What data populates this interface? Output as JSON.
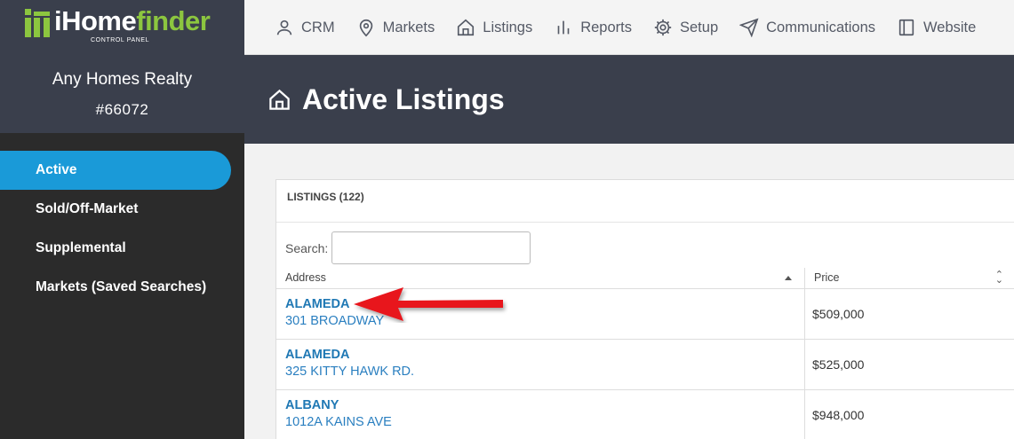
{
  "brand": {
    "name_part1": "iHome",
    "name_part2": "finder",
    "tagline": "CONTROL PANEL",
    "accent": "#8cc63f"
  },
  "account": {
    "name": "Any Homes Realty",
    "id": "#66072"
  },
  "sidebar": {
    "items": [
      {
        "label": "Active",
        "active": true
      },
      {
        "label": "Sold/Off-Market",
        "active": false
      },
      {
        "label": "Supplemental",
        "active": false
      },
      {
        "label": "Markets (Saved Searches)",
        "active": false
      }
    ]
  },
  "topnav": {
    "items": [
      {
        "label": "CRM",
        "icon": "user-icon"
      },
      {
        "label": "Markets",
        "icon": "map-pin-icon"
      },
      {
        "label": "Listings",
        "icon": "home-icon"
      },
      {
        "label": "Reports",
        "icon": "bar-chart-icon"
      },
      {
        "label": "Setup",
        "icon": "gear-icon"
      },
      {
        "label": "Communications",
        "icon": "send-icon"
      },
      {
        "label": "Website",
        "icon": "layout-icon"
      }
    ]
  },
  "header": {
    "title": "Active Listings",
    "icon": "home-icon"
  },
  "listings": {
    "heading": "LISTINGS (122)",
    "search_label": "Search:",
    "search_value": "",
    "columns": [
      "Address",
      "Price"
    ],
    "rows": [
      {
        "city": "ALAMEDA",
        "street": "301 BROADWAY",
        "price": "$509,000"
      },
      {
        "city": "ALAMEDA",
        "street": "325 KITTY HAWK RD.",
        "price": "$525,000"
      },
      {
        "city": "ALBANY",
        "street": "1012A KAINS AVE",
        "price": "$948,000"
      }
    ]
  },
  "colors": {
    "sidebar_bg": "#2b2b2b",
    "header_bg": "#3a3f4c",
    "active_nav": "#1a9ad8",
    "link": "#1f78b4",
    "annotation_arrow": "#e8121b"
  }
}
